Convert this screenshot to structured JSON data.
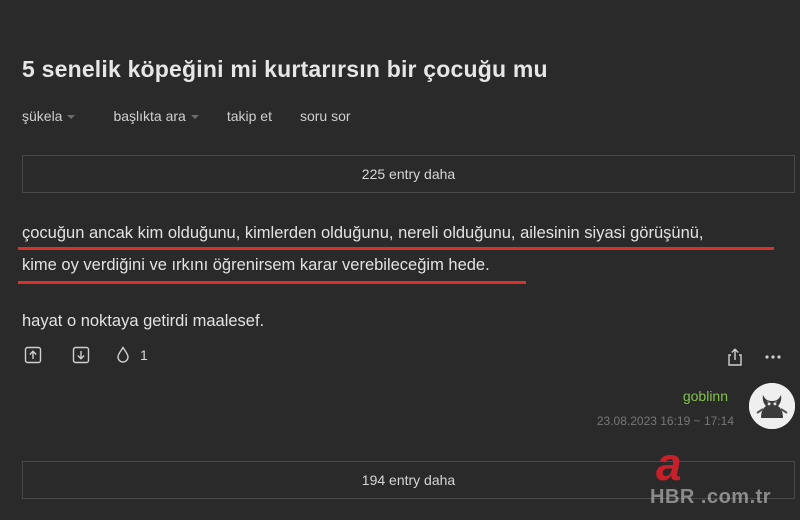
{
  "topic": {
    "title": "5 senelik köpeğini mi kurtarırsın bir çocuğu mu"
  },
  "subnav": {
    "sukela": "şükela",
    "search_in_topic": "başlıkta ara",
    "follow": "takip et",
    "ask": "soru sor"
  },
  "more_top": "225 entry daha",
  "entry": {
    "line1": "çocuğun ancak kim olduğunu, kimlerden olduğunu, nereli olduğunu, ailesinin siyasi görüşünü,",
    "line2": "kime oy verdiğini ve ırkını öğrenirsem karar verebileceğim hede.",
    "line3": "hayat o noktaya getirdi maalesef.",
    "favorite_count": "1",
    "author": "goblinn",
    "date": "23.08.2023 16:19 ~ 17:14"
  },
  "more_bottom": "194 entry daha",
  "watermark": {
    "logo_letter": "a",
    "text": "HBR .com.tr"
  },
  "colors": {
    "background": "#2a2a2a",
    "author": "#81c14b",
    "underline": "#d8322a",
    "watermark_red": "#c7202a"
  },
  "icons": {
    "upvote": "arrow-up-box-icon",
    "downvote": "arrow-down-box-icon",
    "favorite": "drop-icon",
    "share": "share-icon",
    "more": "ellipsis-icon"
  }
}
